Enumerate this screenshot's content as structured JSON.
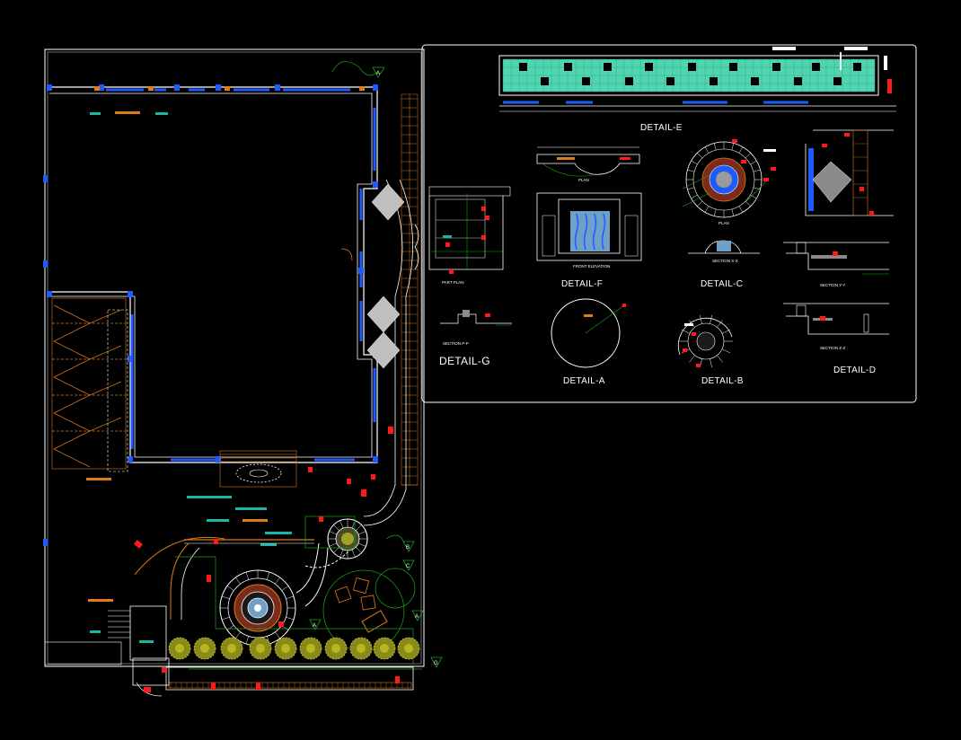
{
  "drawing": {
    "detail_labels": {
      "detail_e": "DETAIL-E",
      "detail_f": "DETAIL-F",
      "detail_c": "DETAIL-C",
      "detail_g": "DETAIL-G",
      "detail_a": "DETAIL-A",
      "detail_b": "DETAIL-B",
      "detail_d": "DETAIL-D"
    },
    "sub_labels": {
      "plan_f": "PLAN",
      "front_elevation": "FRONT ELEVATION",
      "plan_c": "PLAN",
      "section_xx": "SECTION X-X",
      "section_yy": "SECTION Y-Y",
      "section_zz": "SECTION Z-Z",
      "part_plan": "PART PLAN",
      "section_pp": "SECTION P-P"
    },
    "markers": [
      "A",
      "A",
      "B",
      "C",
      "A",
      "G"
    ],
    "colors": {
      "background": "#000000",
      "lines": "#ffffff",
      "walls": "#1e5bff",
      "hatch": "#e07b1a",
      "landscape": "#19a319",
      "dims": "#ff1a1a",
      "text": "#18b7a6",
      "pool_tile": "#4fd6b0",
      "shrubs": "#b8b81e"
    }
  }
}
